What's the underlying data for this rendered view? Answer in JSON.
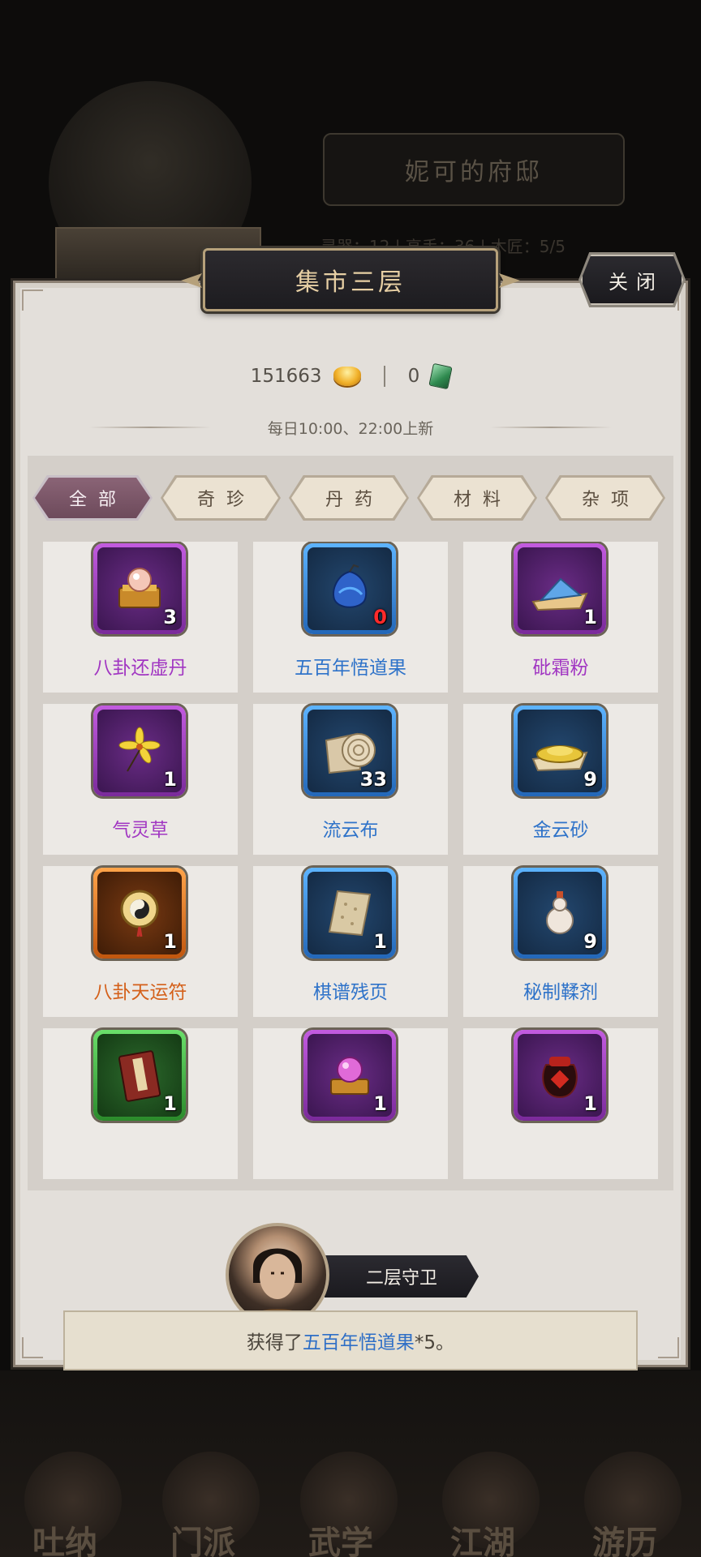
{
  "background": {
    "mansion_title": "妮可的府邸",
    "stats_text": "灵器：12 | 高手：36 | 木匠：5/5",
    "nav": [
      "吐纳",
      "门派",
      "武学",
      "江湖",
      "游历"
    ]
  },
  "panel": {
    "title": "集市三层",
    "close_label": "关闭",
    "currency": {
      "gold_amount": "151663",
      "jade_amount": "0"
    },
    "refresh_note": "每日10:00、22:00上新",
    "tabs": [
      {
        "label": "全部",
        "active": true
      },
      {
        "label": "奇珍",
        "active": false
      },
      {
        "label": "丹药",
        "active": false
      },
      {
        "label": "材料",
        "active": false
      },
      {
        "label": "杂项",
        "active": false
      }
    ],
    "items": [
      {
        "name": "八卦还虚丹",
        "qty": "3",
        "rarity": "purple",
        "icon": "pill-box-icon"
      },
      {
        "name": "五百年悟道果",
        "qty": "0",
        "rarity": "blue",
        "icon": "fruit-icon"
      },
      {
        "name": "砒霜粉",
        "qty": "1",
        "rarity": "purple",
        "icon": "powder-icon"
      },
      {
        "name": "气灵草",
        "qty": "1",
        "rarity": "purple",
        "icon": "herb-flower-icon"
      },
      {
        "name": "流云布",
        "qty": "33",
        "rarity": "blue",
        "icon": "cloth-roll-icon"
      },
      {
        "name": "金云砂",
        "qty": "9",
        "rarity": "blue",
        "icon": "sand-pile-icon"
      },
      {
        "name": "八卦天运符",
        "qty": "1",
        "rarity": "orange",
        "icon": "bagua-talisman-icon"
      },
      {
        "name": "棋谱残页",
        "qty": "1",
        "rarity": "blue",
        "icon": "paper-scrap-icon"
      },
      {
        "name": "秘制鞣剂",
        "qty": "9",
        "rarity": "blue",
        "icon": "gourd-bottle-icon"
      },
      {
        "name": "",
        "qty": "1",
        "rarity": "green",
        "icon": "book-icon"
      },
      {
        "name": "",
        "qty": "1",
        "rarity": "purple",
        "icon": "orb-pedestal-icon"
      },
      {
        "name": "",
        "qty": "1",
        "rarity": "purple",
        "icon": "wine-jar-icon"
      }
    ],
    "guard_label": "二层守卫",
    "toast": {
      "prefix": "获得了",
      "item": "五百年悟道果",
      "suffix": "*5。"
    }
  }
}
